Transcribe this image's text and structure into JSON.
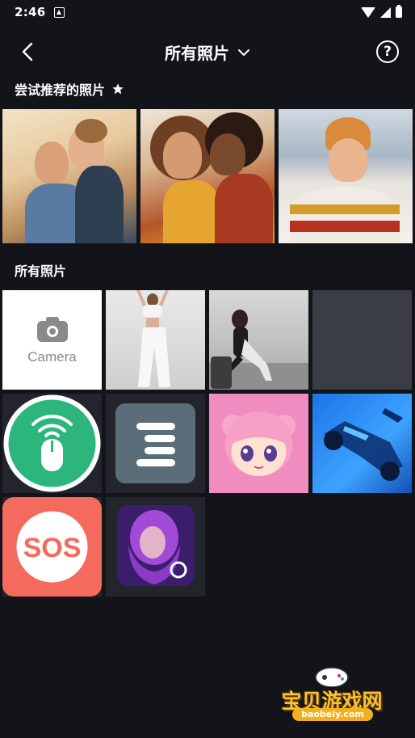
{
  "status_bar": {
    "time": "2:46"
  },
  "header": {
    "title": "所有照片",
    "back_icon": "chevron-left-icon",
    "help_icon": "help-circle-icon",
    "dropdown_icon": "chevron-down-icon"
  },
  "recommended": {
    "title": "尝试推荐的照片",
    "photo_count": 3
  },
  "all_photos": {
    "title": "所有照片",
    "camera_label": "Camera"
  },
  "watermark": {
    "name": "宝贝游戏网",
    "url": "baobeiy.com"
  },
  "colors": {
    "background": "#121419",
    "accent_green": "#2cb67d",
    "sos_red": "#f46b5d"
  }
}
